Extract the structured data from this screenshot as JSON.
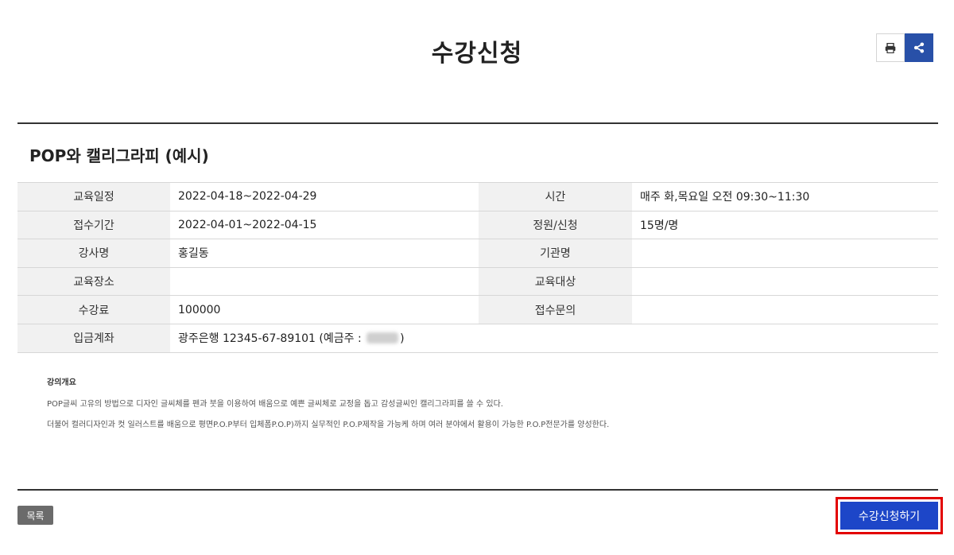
{
  "page": {
    "title": "수강신청"
  },
  "toolbar": {
    "print_icon": "print-icon",
    "share_icon": "share-icon",
    "accent_color": "#2850a8"
  },
  "course": {
    "title": "POP와 캘리그라피 (예시)",
    "rows": [
      {
        "label1": "교육일정",
        "value1": "2022-04-18~2022-04-29",
        "label2": "시간",
        "value2": "매주 화,목요일 오전 09:30~11:30"
      },
      {
        "label1": "접수기간",
        "value1": "2022-04-01~2022-04-15",
        "label2": "정원/신청",
        "value2": "15명/명"
      },
      {
        "label1": "강사명",
        "value1": "홍길동",
        "label2": "기관명",
        "value2": ""
      },
      {
        "label1": "교육장소",
        "value1": "",
        "label2": "교육대상",
        "value2": ""
      },
      {
        "label1": "수강료",
        "value1": "100000",
        "label2": "접수문의",
        "value2": ""
      }
    ],
    "account": {
      "label": "입금계좌",
      "value_prefix": "광주은행 12345-67-89101 (예금주 : ",
      "value_suffix": ")"
    }
  },
  "description": {
    "heading": "강의개요",
    "lines": [
      "POP글씨 고유의 방법으로 디자인 글씨체를 펜과 붓을 이용하여 배움으로 예쁜 글씨체로 교정을 돕고 감성글씨인 캘리그라피를 쓸 수 있다.",
      "더불어 컬러디자인과 컷 일러스트를 배움으로 평면P.O.P부터 입체폼P.O.P)까지 실무적인 P.O.P제작을 가능케 하며 여러 분야에서 활용이 가능한 P.O.P전문가를 양성한다."
    ]
  },
  "footer": {
    "list_label": "목록",
    "apply_label": "수강신청하기",
    "apply_color": "#1d46c8",
    "highlight_color": "#e30000"
  }
}
